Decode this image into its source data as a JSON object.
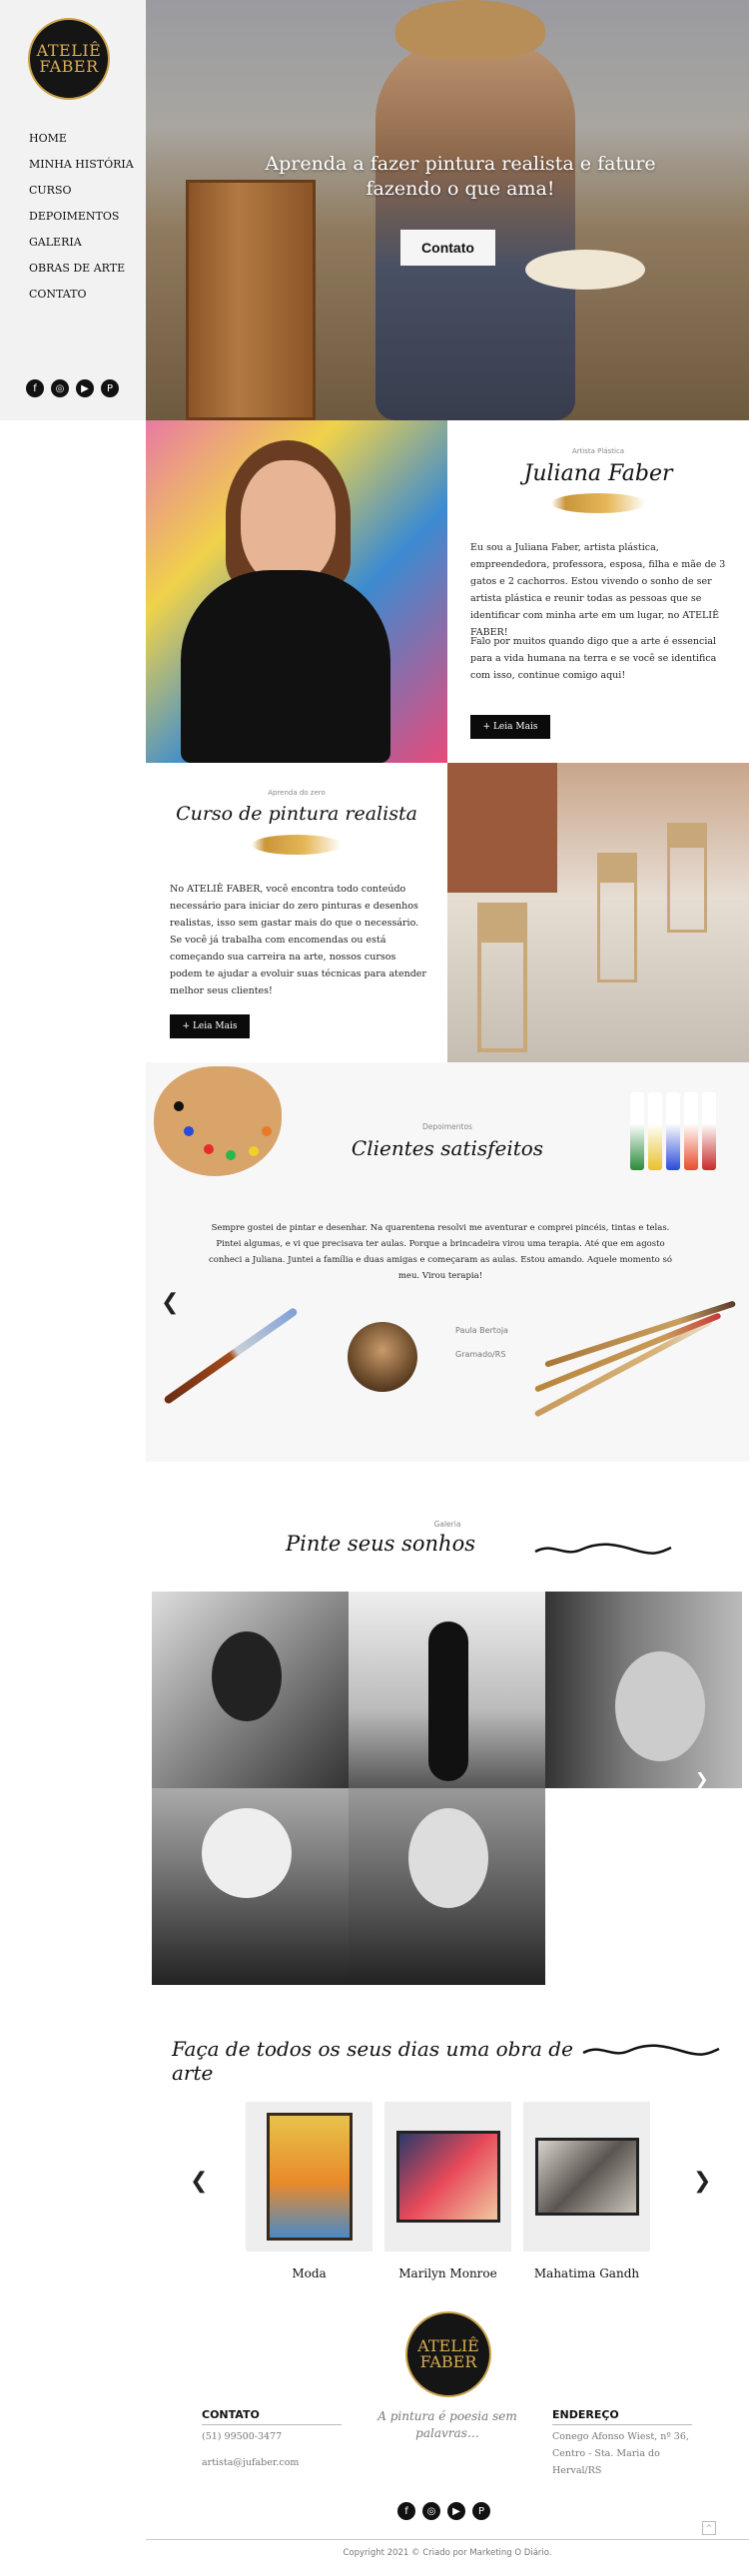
{
  "brand": {
    "logo_line1": "ATELIÊ",
    "logo_line2": "FABER",
    "accent": "#d8ad52"
  },
  "nav": {
    "items": [
      "HOME",
      "MINHA HISTÓRIA",
      "CURSO",
      "DEPOIMENTOS",
      "GALERIA",
      "OBRAS DE ARTE",
      "CONTATO"
    ]
  },
  "social": {
    "icons": [
      "facebook-icon",
      "instagram-icon",
      "youtube-icon",
      "pinterest-icon"
    ],
    "glyphs": [
      "f",
      "◎",
      "▶",
      "P"
    ]
  },
  "hero": {
    "title": "Aprenda a fazer pintura realista e fature fazendo o que ama!",
    "button": "Contato"
  },
  "about": {
    "kicker": "Artista Plástica",
    "name": "Juliana Faber",
    "p1": "Eu sou a Juliana Faber, artista plástica, empreendedora, professora, esposa, filha e mãe de 3 gatos e 2 cachorros. Estou vivendo o sonho de ser artista plástica e reunir todas as pessoas que se identificar com minha arte em um lugar, no ATELIÊ FABER!",
    "p2": "Falo por muitos quando digo que a arte é essencial para a vida humana na terra e se você se identifica com isso, continue comigo aqui!",
    "button": "+ Leia Mais"
  },
  "course": {
    "kicker": "Aprenda do zero",
    "title": "Curso de pintura realista",
    "p1": "No ATELIÊ FABER, você encontra todo conteúdo necessário para iniciar do zero pinturas e desenhos realistas, isso sem gastar mais do que o necessário. Se você já trabalha com encomendas ou está começando sua carreira na arte, nossos cursos podem te ajudar a evoluir suas técnicas para atender melhor seus clientes!",
    "button": "+ Leia Mais"
  },
  "testimonials": {
    "kicker": "Depoimentos",
    "title": "Clientes satisfeitos",
    "text": "Sempre gostei de pintar e desenhar. Na quarentena resolvi me aventurar e comprei pincéis, tintas e telas. Pintei algumas, e vi que precisava ter aulas. Porque a brincadeira virou uma terapia. Até que em agosto conheci a Juliana. Juntei a família e duas amigas e começaram as aulas. Estou amando. Aquele momento só meu. Virou terapia!",
    "author": "Paula Bertoja",
    "location": "Gramado/RS",
    "prev": "❮"
  },
  "gallery": {
    "kicker": "Galeria",
    "title": "Pinte seus sonhos",
    "next": "❯"
  },
  "works": {
    "title": "Faça de todos os seus dias uma obra de arte",
    "prev": "❮",
    "next": "❯",
    "items": [
      {
        "label": "Moda",
        "bg": "#e8c24a",
        "fg": "#e88a2a"
      },
      {
        "label": "Marilyn Monroe",
        "bg": "#2a3a6a",
        "fg": "#e84a5a"
      },
      {
        "label": "Mahatima Gandh",
        "bg": "#c9c4ba",
        "fg": "#5a5550"
      }
    ]
  },
  "footer": {
    "logo_line1": "ATELIÊ",
    "logo_line2": "FABER",
    "contact_heading": "CONTATO",
    "phone": "(51) 99500-3477",
    "email": "artista@jufaber.com",
    "tagline": "A pintura é poesia sem palavras…",
    "address_heading": "ENDEREÇO",
    "address": "Conego Afonso Wiest, nº 36, Centro - Sta. Maria do Herval/RS",
    "copyright": "Copyright 2021 © Criado por Marketing O Diário.",
    "to_top": "^"
  }
}
